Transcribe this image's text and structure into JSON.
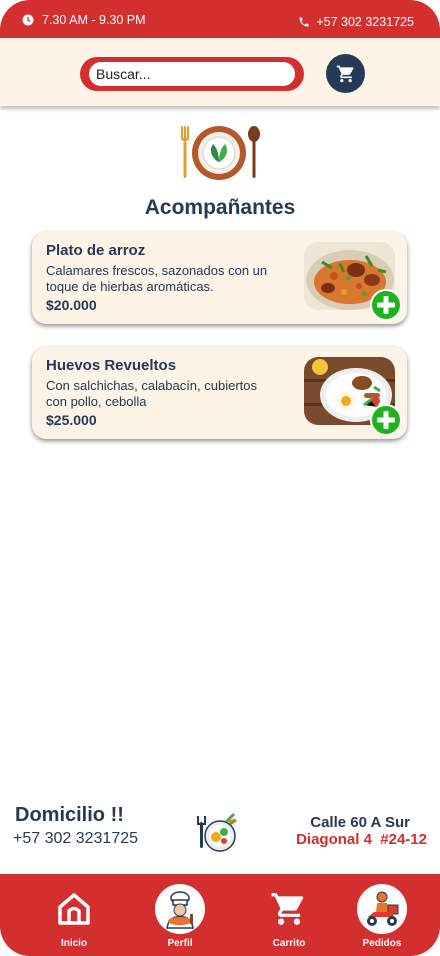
{
  "status_bar": {
    "time_range": "7.30 AM - 9.30 PM",
    "phone": "+57 302 3231725"
  },
  "search": {
    "placeholder": "Buscar..."
  },
  "category": {
    "title": "Acompañantes"
  },
  "products": [
    {
      "name": "Plato de arroz",
      "description": "Calamares frescos, sazonados con un toque de hierbas aromáticas.",
      "price": "$20.000"
    },
    {
      "name": "Huevos Revueltos",
      "description": "Con salchichas, calabacín, cubiertos con pollo, cebolla",
      "price": "$25.000"
    }
  ],
  "footer_info": {
    "delivery_title": "Domicilio !!",
    "delivery_phone": "+57 302 3231725",
    "address_line1": "Calle 60 A Sur",
    "address_line2": "Diagonal 4  #24-12"
  },
  "bottom_nav": {
    "items": [
      {
        "label": "Inicio",
        "icon": "home-icon"
      },
      {
        "label": "Perfil",
        "icon": "chef-avatar-icon"
      },
      {
        "label": "Carrito",
        "icon": "cart-icon"
      },
      {
        "label": "Pedidos",
        "icon": "delivery-avatar-icon"
      }
    ]
  },
  "colors": {
    "primary_red": "#d32f2f",
    "navy": "#263a55",
    "cream": "#fdf3e7",
    "add_green": "#1db31d"
  }
}
